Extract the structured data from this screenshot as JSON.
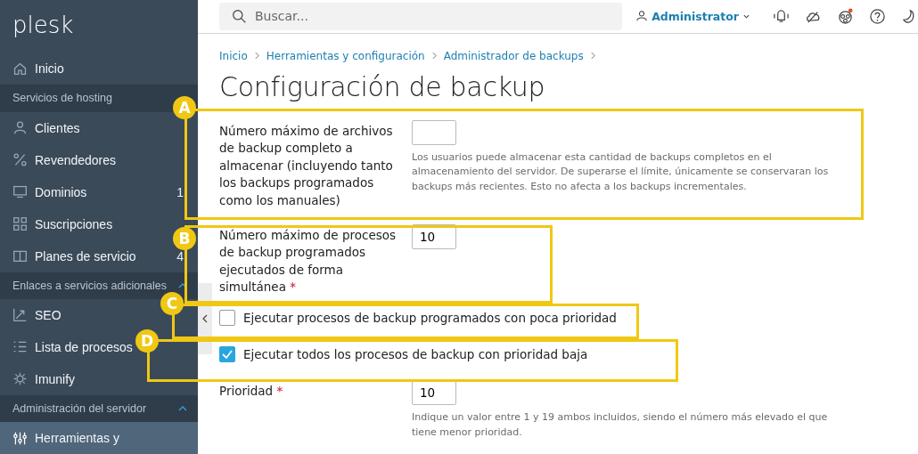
{
  "logo": "plesk",
  "sidebar": [
    {
      "kind": "item",
      "label": "Inicio",
      "selected": false
    },
    {
      "kind": "section",
      "label": "Servicios de hosting"
    },
    {
      "kind": "item",
      "label": "Clientes",
      "selected": false
    },
    {
      "kind": "item",
      "label": "Revendedores",
      "selected": false
    },
    {
      "kind": "item",
      "label": "Dominios",
      "count": "1",
      "selected": false
    },
    {
      "kind": "item",
      "label": "Suscripciones",
      "selected": false
    },
    {
      "kind": "item",
      "label": "Planes de servicio",
      "count": "4",
      "selected": false
    },
    {
      "kind": "section",
      "label": "Enlaces a servicios adicionales",
      "expanded": true
    },
    {
      "kind": "item",
      "label": "SEO",
      "selected": false
    },
    {
      "kind": "item",
      "label": "Lista de procesos",
      "selected": false
    },
    {
      "kind": "item",
      "label": "Imunify",
      "selected": false
    },
    {
      "kind": "section",
      "label": "Administración del servidor",
      "expanded": true
    },
    {
      "kind": "item",
      "label": "Herramientas y",
      "selected": true
    }
  ],
  "search": {
    "placeholder": "Buscar..."
  },
  "user": {
    "name": "Administrator"
  },
  "notification_dot": true,
  "breadcrumb": [
    "Inicio",
    "Herramientas y configuración",
    "Administrador de backups"
  ],
  "title": "Configuración de backup",
  "form": [
    {
      "kind": "number",
      "label": "Número máximo de archivos de backup completo a almacenar (incluyendo tanto los backups programados como los manuales)",
      "hint": "Los usuarios puede almacenar esta cantidad de backups completos en el almacenamiento del servidor. De superarse el límite, únicamente se conservaran los backups más recientes. Esto no afecta a los backups incrementales."
    },
    {
      "kind": "number",
      "label": "Número máximo de procesos de backup programados ejecutados de forma simultánea",
      "required_mark": "*",
      "value": "10"
    },
    {
      "kind": "checkbox",
      "label": "Ejecutar procesos de backup programados con poca prioridad",
      "checked": false
    },
    {
      "kind": "checkbox",
      "label": "Ejecutar todos los procesos de backup con prioridad baja",
      "checked": true
    },
    {
      "kind": "number",
      "label": "Prioridad",
      "required_mark": "*",
      "value": "10",
      "hint": "Indique un valor entre 1 y 19 ambos incluidos, siendo el número más elevado el que tiene menor prioridad."
    }
  ],
  "callouts": [
    "A",
    "B",
    "C",
    "D"
  ]
}
